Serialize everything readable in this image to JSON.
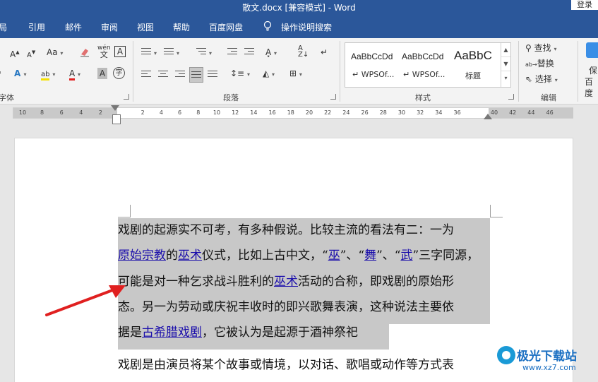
{
  "window": {
    "title": "散文.docx [兼容模式]  -  Word",
    "login_label": "登录"
  },
  "menu": {
    "items": [
      "局",
      "引用",
      "邮件",
      "审阅",
      "视图",
      "帮助",
      "百度网盘"
    ],
    "tell_me": "操作说明搜索"
  },
  "ribbon": {
    "groups": {
      "font": "字体",
      "paragraph": "段落",
      "styles": "样式",
      "editing": "编辑"
    },
    "font_buttons": {
      "grow": "A",
      "shrink": "A",
      "case": "Aa",
      "phonetic": "wén\n文",
      "border_char": "A",
      "shade_char": "A",
      "enclose": "字"
    },
    "styles": [
      {
        "preview": "AaBbCcDd",
        "name": "WPSOf..."
      },
      {
        "preview": "AaBbCcDd",
        "name": "WPSOf..."
      },
      {
        "preview": "AaBbC",
        "name": "标题"
      }
    ],
    "editing": {
      "find": "查找",
      "replace": "替换",
      "select": "选择"
    },
    "baidu": {
      "save": "保",
      "baidu": "百度"
    }
  },
  "ruler": {
    "left_numbers": [
      "10",
      "8",
      "6",
      "4",
      "2"
    ],
    "right_numbers": [
      "2",
      "4",
      "6",
      "8",
      "10",
      "12",
      "14",
      "16",
      "18",
      "20",
      "22",
      "24",
      "26",
      "28",
      "30",
      "32",
      "34",
      "36",
      "40",
      "42",
      "44",
      "46"
    ]
  },
  "document": {
    "line1": "戏剧的起源实不可考，有多种假说。比较主流的看法有二：一为",
    "line2": {
      "link1": "原始宗教",
      "t1": "的",
      "link2": "巫术",
      "t2": "仪式，比如上古中文，“",
      "link3": "巫",
      "t3": "”、“",
      "link4": "舞",
      "t4": "”、“",
      "link5": "武",
      "t5": "”三字同源，"
    },
    "line3": {
      "t1": "可能是对一种乞求战斗胜利的",
      "link1": "巫术",
      "t2": "活动的合称，即戏剧的原始形"
    },
    "line4": "态。另一为劳动或庆祝丰收时的即兴歌舞表演，这种说法主要依",
    "line5": {
      "t1": "据是",
      "link1": "古希腊戏剧",
      "t2": "，它被认为是起源于酒神祭祀"
    },
    "line6": "戏剧是由演员将某个故事或情境，以对话、歌唱或动作等方式表"
  },
  "watermark": {
    "brand": "极光下载站",
    "url": "www.xz7.com"
  },
  "colors": {
    "title_blue": "#2b579a",
    "selection": "#c8c8c8",
    "link": "#1a0dab",
    "arrow_red": "#e02020"
  }
}
